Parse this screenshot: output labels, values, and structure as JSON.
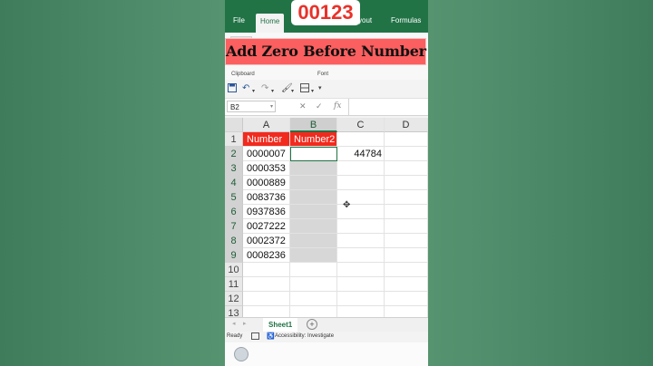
{
  "overlay": {
    "badge": "00123",
    "banner": "Add Zero Before Number"
  },
  "ribbon": {
    "tabs": [
      "File",
      "Home",
      "Page Layout",
      "Formulas"
    ],
    "tab_visible_fragment": "yout",
    "active_tab": "Home",
    "groups": [
      "Clipboard",
      "Font"
    ]
  },
  "formula_bar": {
    "name_box": "B2",
    "value": ""
  },
  "sheet": {
    "columns": [
      "A",
      "B",
      "C",
      "D"
    ],
    "selected_column": "B",
    "rows": [
      {
        "n": "1",
        "a": "Number",
        "b": "Number2",
        "c": "",
        "d": ""
      },
      {
        "n": "2",
        "a": "0000007",
        "b": "",
        "c": "44784",
        "d": ""
      },
      {
        "n": "3",
        "a": "0000353",
        "b": "",
        "c": "",
        "d": ""
      },
      {
        "n": "4",
        "a": "0000889",
        "b": "",
        "c": "",
        "d": ""
      },
      {
        "n": "5",
        "a": "0083736",
        "b": "",
        "c": "",
        "d": ""
      },
      {
        "n": "6",
        "a": "0937836",
        "b": "",
        "c": "",
        "d": ""
      },
      {
        "n": "7",
        "a": "0027222",
        "b": "",
        "c": "",
        "d": ""
      },
      {
        "n": "8",
        "a": "0002372",
        "b": "",
        "c": "",
        "d": ""
      },
      {
        "n": "9",
        "a": "0008236",
        "b": "",
        "c": "",
        "d": ""
      },
      {
        "n": "10",
        "a": "",
        "b": "",
        "c": "",
        "d": ""
      },
      {
        "n": "11",
        "a": "",
        "b": "",
        "c": "",
        "d": ""
      },
      {
        "n": "12",
        "a": "",
        "b": "",
        "c": "",
        "d": ""
      },
      {
        "n": "13",
        "a": "",
        "b": "",
        "c": "",
        "d": ""
      }
    ]
  },
  "sheet_tabs": [
    "Sheet1"
  ],
  "status": {
    "ready": "Ready",
    "accessibility": "Accessibility: Investigate"
  },
  "colors": {
    "excel_green": "#217346",
    "header_red": "#f22a1e",
    "badge_red": "#e8322a",
    "banner_bg": "#fb5f5f"
  },
  "icons": [
    "save-icon",
    "undo-icon",
    "redo-icon",
    "format-painter-icon",
    "border-icon",
    "cancel-icon",
    "enter-icon",
    "fx-icon",
    "add-sheet-icon",
    "cell-cursor-icon"
  ]
}
